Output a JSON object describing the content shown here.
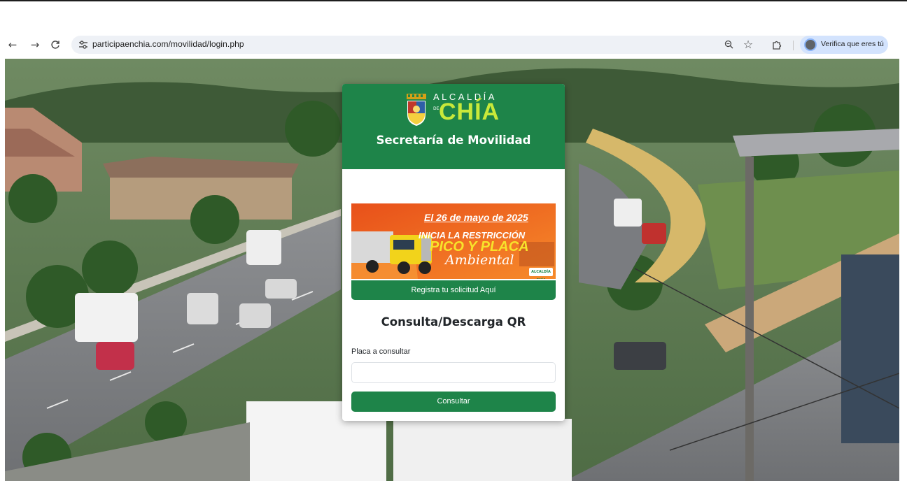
{
  "browser": {
    "back_icon": "←",
    "forward_icon": "→",
    "reload_icon": "C",
    "site_info_icon": "tune-icon",
    "url": "participaenchia.com/movilidad/login.php",
    "zoom_icon": "zoom-icon",
    "star_icon": "☆",
    "extensions_icon": "puzzle-icon",
    "profile_label": "Verifica que eres tú"
  },
  "header": {
    "logo_top": "ALCALDÍA",
    "logo_de": "DE",
    "logo_main": "CHÍA",
    "title": "Secretaría de Movilidad"
  },
  "banner": {
    "date": "El 26 de mayo de 2025",
    "line1": "INICIA LA RESTRICCIÓN",
    "line2": "PICO Y PLACA",
    "line3": "Ambiental",
    "badge": "ALCALDÍA CHÍA",
    "background": "#f26b1d",
    "accent": "#f7e32b"
  },
  "register_button": "Registra tu solicitud Aquí",
  "form": {
    "title": "Consulta/Descarga QR",
    "plate_label": "Placa a consultar",
    "plate_value": "",
    "plate_placeholder": "",
    "submit_label": "Consultar"
  },
  "colors": {
    "primary_green": "#1e8449",
    "logo_yellow_green": "#c9e93a"
  }
}
